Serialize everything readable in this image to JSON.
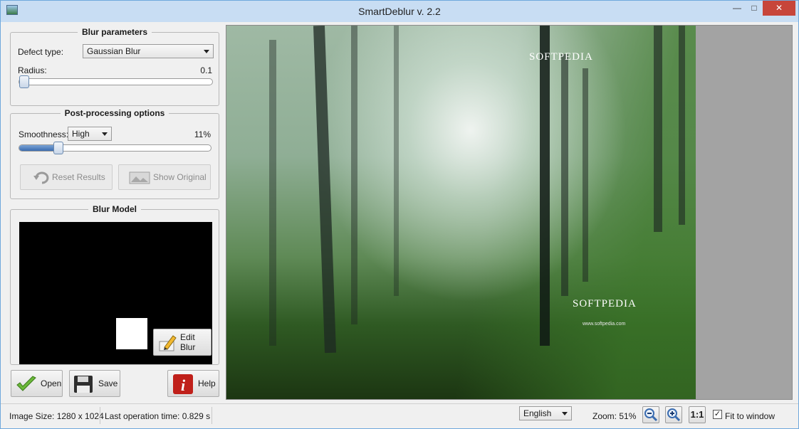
{
  "window": {
    "title": "SmartDeblur v. 2.2"
  },
  "blur_params": {
    "title": "Blur parameters",
    "defect_label": "Defect type:",
    "defect_value": "Gaussian Blur",
    "radius_label": "Radius:",
    "radius_value": "0.1",
    "radius_fraction": 0.0
  },
  "post": {
    "title": "Post-processing options",
    "smoothness_label": "Smoothness:",
    "smoothness_value": "High",
    "smoothness_percent": "11%",
    "smoothness_fraction": 0.11,
    "reset_label": "Reset Results",
    "show_original_label": "Show Original"
  },
  "blur_model": {
    "title": "Blur Model",
    "edit_label": "Edit Blur"
  },
  "actions": {
    "open_label": "Open",
    "save_label": "Save",
    "help_label": "Help"
  },
  "image": {
    "watermark_top": "SOFTPEDIA",
    "watermark_mid": "SOFTPEDIA",
    "watermark_url": "www.softpedia.com"
  },
  "status": {
    "image_size": "Image Size: 1280 x 1024",
    "last_op": "Last operation time: 0.829 s",
    "language": "English",
    "zoom": "Zoom: 51%",
    "one_to_one": "1:1",
    "fit_label": "Fit to window",
    "fit_checked": true
  },
  "colors": {
    "accent": "#3a6cb0",
    "close": "#c7453a",
    "help": "#c0201a",
    "open": "#5aa02c"
  }
}
